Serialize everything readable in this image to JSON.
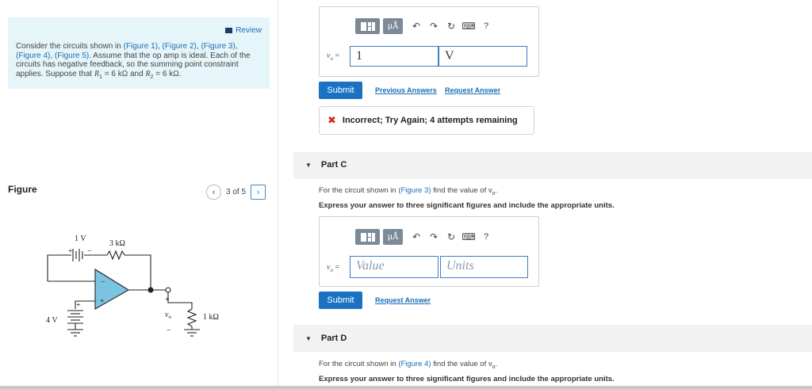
{
  "review": "Review",
  "intro": {
    "p1": "Consider the circuits shown in ",
    "fig1": "(Figure 1)",
    "fig2": "(Figure 2)",
    "fig3": "(Figure 3)",
    "fig4": "(Figure 4)",
    "fig5": "(Figure 5)",
    "p2": ". Assume that the op amp is ideal. Each of the circuits has negative feedback, so the summing point constraint applies. Suppose that ",
    "r1": "R",
    "r1sub": "1",
    "r1val": " = 6 kΩ and ",
    "r2": "R",
    "r2sub": "2",
    "r2val": " = 6 kΩ."
  },
  "figure": {
    "title": "Figure",
    "pager": "3 of 5",
    "labels": {
      "v1": "1 V",
      "r": "3 kΩ",
      "v4": "4 V",
      "rl": "1 kΩ",
      "vo": "v",
      "vo_sub": "o",
      "plus": "+",
      "minus": "−"
    }
  },
  "toolbar": {
    "mu": "μÅ",
    "undo": "↶",
    "redo": "↷",
    "reset": "↻",
    "keyboard": "⌨",
    "help": "?"
  },
  "part_b": {
    "label": "v",
    "label_sub": "o",
    "label_eq": " =",
    "value": "1",
    "units": "V",
    "submit": "Submit",
    "prev": "Previous Answers",
    "request": "Request Answer",
    "feedback": "Incorrect; Try Again; 4 attempts remaining",
    "feedback_icon": "✖"
  },
  "part_c": {
    "title": "Part C",
    "q_pre": "For the circuit shown in ",
    "q_link": "(Figure 3)",
    "q_post": " find the value of v",
    "q_sub": "o",
    "q_end": ".",
    "instr": "Express your answer to three significant figures and include the appropriate units.",
    "value_placeholder": "Value",
    "units_placeholder": "Units",
    "label": "v",
    "label_sub": "o",
    "label_eq": " =",
    "submit": "Submit",
    "request": "Request Answer"
  },
  "part_d": {
    "title": "Part D",
    "q_pre": "For the circuit shown in ",
    "q_link": "(Figure 4)",
    "q_post": " find the value of v",
    "q_sub": "o",
    "q_end": ".",
    "instr": "Express your answer to three significant figures and include the appropriate units."
  }
}
